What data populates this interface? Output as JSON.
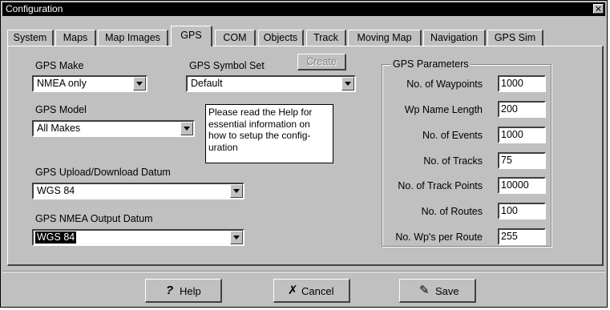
{
  "window": {
    "title": "Configuration",
    "close_glyph": "✕"
  },
  "tabs": [
    {
      "label": "System"
    },
    {
      "label": "Maps"
    },
    {
      "label": "Map Images"
    },
    {
      "label": "GPS"
    },
    {
      "label": "COM"
    },
    {
      "label": "Objects"
    },
    {
      "label": "Track"
    },
    {
      "label": "Moving Map"
    },
    {
      "label": "Navigation"
    },
    {
      "label": "GPS Sim"
    }
  ],
  "active_tab": "GPS",
  "gps": {
    "make_label": "GPS Make",
    "make_value": "NMEA only",
    "symbol_set_label": "GPS Symbol Set",
    "symbol_set_value": "Default",
    "create_label": "Create",
    "model_label": "GPS Model",
    "model_value": "All Makes",
    "note_lines": "Please read the Help for\nessential information on\nhow to setup the config-\nuration",
    "upload_datum_label": "GPS Upload/Download Datum",
    "upload_datum_value": "WGS 84",
    "nmea_datum_label": "GPS NMEA Output Datum",
    "nmea_datum_value": "WGS 84"
  },
  "params": {
    "title": "GPS Parameters",
    "rows": [
      {
        "label": "No. of Waypoints",
        "value": "1000"
      },
      {
        "label": "Wp Name Length",
        "value": "200"
      },
      {
        "label": "No. of Events",
        "value": "1000"
      },
      {
        "label": "No. of Tracks",
        "value": "75"
      },
      {
        "label": "No. of Track Points",
        "value": "10000"
      },
      {
        "label": "No. of Routes",
        "value": "100"
      },
      {
        "label": "No. Wp's per Route",
        "value": "255"
      }
    ]
  },
  "buttons": {
    "help_label": "Help",
    "help_icon": "?",
    "cancel_label": "Cancel",
    "cancel_icon": "✗",
    "save_label": "Save",
    "save_icon": "✎"
  },
  "icons": {
    "dropdown": "chevron-down-icon",
    "help": "question-mark-icon",
    "cancel": "x-mark-icon",
    "save": "disk-pen-icon"
  }
}
